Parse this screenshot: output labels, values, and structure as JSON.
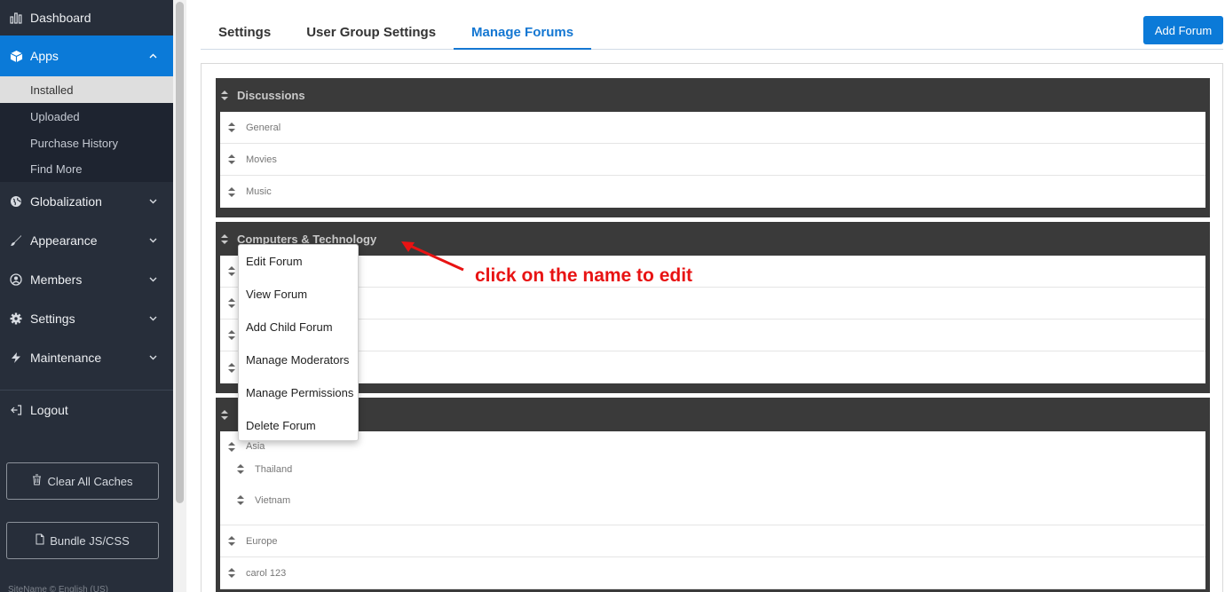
{
  "sidebar": {
    "items": [
      {
        "label": "Dashboard",
        "icon": "chart-icon"
      },
      {
        "label": "Apps",
        "icon": "cube-icon",
        "active": true
      },
      {
        "label": "Globalization",
        "icon": "globe-icon"
      },
      {
        "label": "Appearance",
        "icon": "brush-icon"
      },
      {
        "label": "Members",
        "icon": "user-icon"
      },
      {
        "label": "Settings",
        "icon": "gear-icon"
      },
      {
        "label": "Maintenance",
        "icon": "bolt-icon"
      },
      {
        "label": "Logout",
        "icon": "logout-icon"
      }
    ],
    "apps_sub": [
      "Installed",
      "Uploaded",
      "Purchase History",
      "Find More"
    ],
    "clear_caches": "Clear All Caches",
    "bundle": "Bundle JS/CSS",
    "footer": "SiteName ©  English (US)"
  },
  "tabs": [
    "Settings",
    "User Group Settings",
    "Manage Forums"
  ],
  "add_forum": "Add Forum",
  "categories": [
    {
      "name": "Discussions",
      "forums": [
        "General",
        "Movies",
        "Music"
      ]
    },
    {
      "name": "Computers & Technology",
      "forums": [
        "",
        "",
        "",
        ""
      ]
    },
    {
      "name": "",
      "forums": [
        "Asia",
        "Europe",
        "carol 123"
      ],
      "sub_forums": [
        "Thailand",
        "Vietnam"
      ]
    }
  ],
  "dropdown": [
    "Edit Forum",
    "View Forum",
    "Add Child Forum",
    "Manage Moderators",
    "Manage Permissions",
    "Delete Forum"
  ],
  "annotation": "click on the name to edit",
  "colors": {
    "accent": "#0b7ad8",
    "sidebar": "#272e3a",
    "annotation": "#e81313"
  }
}
